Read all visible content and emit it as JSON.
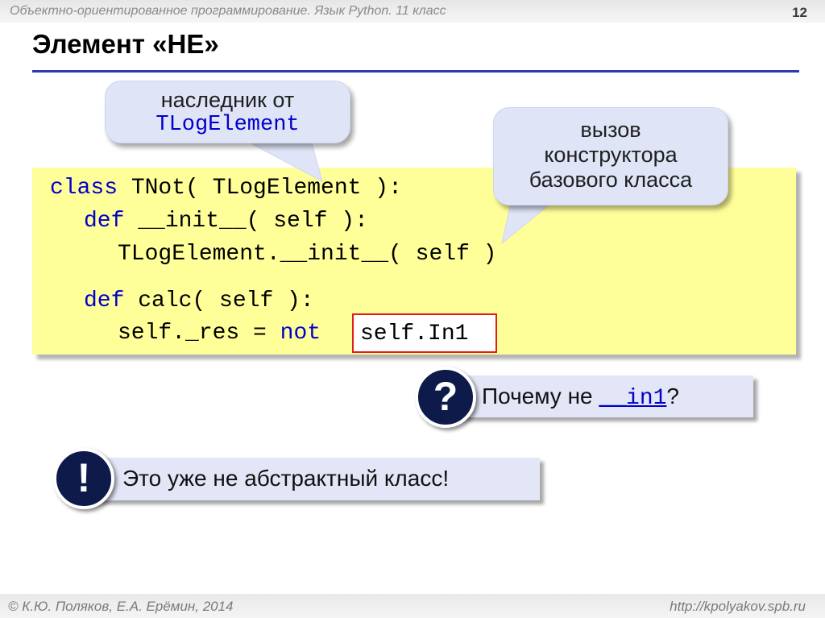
{
  "header": {
    "course": "Объектно-ориентированное программирование. Язык Python. 11 класс",
    "page_number": "12"
  },
  "slide": {
    "title": "Элемент «НЕ»"
  },
  "code": {
    "line1_kw": "class",
    "line1_rest": " TNot( TLogElement ):",
    "line2_kw": "def",
    "line2_rest": " __init__( self ):",
    "line3": "TLogElement.__init__( self )",
    "line4_kw": "def",
    "line4_rest": " calc( self ):",
    "line5_prefix": "self._res = ",
    "line5_kw": "not",
    "line5_framed": "self.In1"
  },
  "callouts": {
    "heir_line1": "наследник от",
    "heir_line2": "TLogElement",
    "ctor_line1": "вызов",
    "ctor_line2": "конструктора",
    "ctor_line3": "базового класса"
  },
  "question": {
    "mark": "?",
    "text_prefix": "Почему не ",
    "code": "__in1",
    "text_suffix": "?"
  },
  "note": {
    "mark": "!",
    "text": "Это уже не абстрактный класс!"
  },
  "footer": {
    "author": "© К.Ю. Поляков, Е.А. Ерёмин, 2014",
    "url": "http://kpolyakov.spb.ru"
  },
  "colors": {
    "keyword": "#0000cc",
    "code_bg": "#ffff99",
    "callout_bg": "#dfe4f7",
    "badge_bg": "#0d1a4a",
    "frame": "#e21b1b",
    "title_rule": "#2b3bb0"
  }
}
